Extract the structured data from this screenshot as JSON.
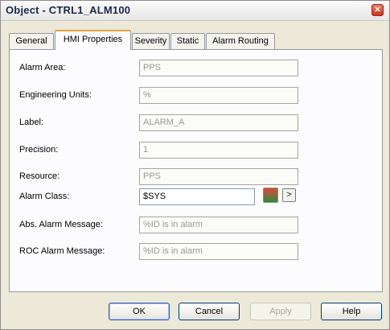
{
  "window": {
    "title": "Object - CTRL1_ALM100"
  },
  "tabs": [
    {
      "label": "General"
    },
    {
      "label": "HMI Properties"
    },
    {
      "label": "Severity"
    },
    {
      "label": "Static"
    },
    {
      "label": "Alarm Routing"
    }
  ],
  "active_tab": "HMI Properties",
  "fields": {
    "alarm_area": {
      "label": "Alarm Area:",
      "value": "PPS"
    },
    "engineering_units": {
      "label": "Engineering Units:",
      "value": "%"
    },
    "label": {
      "label": "Label:",
      "value": "ALARM_A"
    },
    "precision": {
      "label": "Precision:",
      "value": "1"
    },
    "resource": {
      "label": "Resource:",
      "value": "PPS"
    },
    "alarm_class": {
      "label": "Alarm Class:",
      "value": "$SYS",
      "browse_label": ">"
    },
    "abs_alarm_message": {
      "label": "Abs. Alarm Message:",
      "value": "%ID is in alarm"
    },
    "roc_alarm_message": {
      "label": "ROC Alarm Message:",
      "value": "%ID is in alarm"
    }
  },
  "buttons": {
    "ok": "OK",
    "cancel": "Cancel",
    "apply": "Apply",
    "help": "Help"
  },
  "icons": {
    "close": "close-icon",
    "alarm_class": "alarm-class-icon"
  }
}
